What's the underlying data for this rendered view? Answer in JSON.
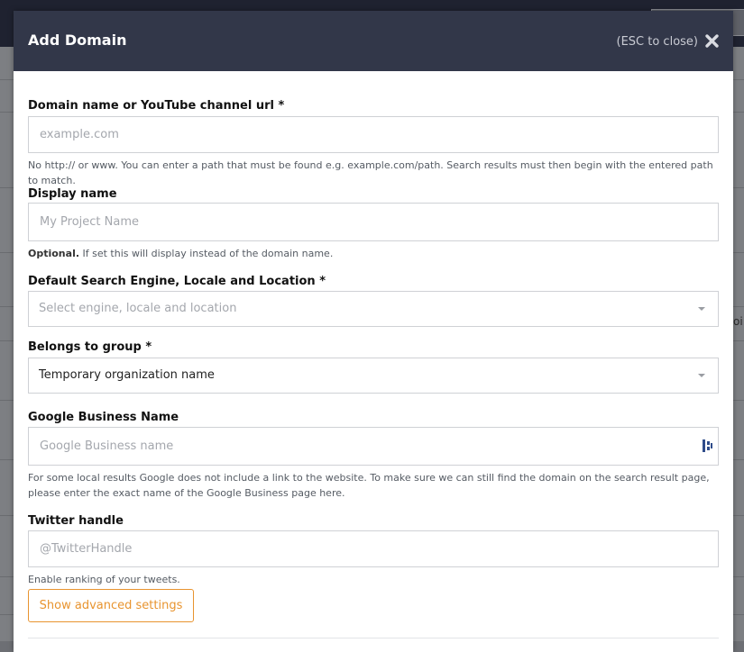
{
  "modal": {
    "title": "Add Domain",
    "esc_hint": "(ESC to close)"
  },
  "fields": {
    "domain": {
      "label": "Domain name or YouTube channel url *",
      "placeholder": "example.com",
      "value": "",
      "help": "No http:// or www. You can enter a path that must be found e.g. example.com/path. Search results must then begin with the entered path to match."
    },
    "display_name": {
      "label": "Display name",
      "placeholder": "My Project Name",
      "value": "",
      "help_bold": "Optional.",
      "help": "If set this will display instead of the domain name."
    },
    "search_engine": {
      "label": "Default Search Engine, Locale and Location *",
      "placeholder": "Select engine, locale and location"
    },
    "group": {
      "label": "Belongs to group *",
      "selected": "Temporary organization name"
    },
    "google_business": {
      "label": "Google Business Name",
      "placeholder": "Google Business name",
      "value": "",
      "help": "For some local results Google does not include a link to the website. To make sure we can still find the domain on the search result page, please enter the exact name of the Google Business page here."
    },
    "twitter": {
      "label": "Twitter handle",
      "placeholder": "@TwitterHandle",
      "value": "",
      "help": "Enable ranking of your tweets."
    }
  },
  "advanced_button": "Show advanced settings",
  "background": {
    "edge_text": "oi"
  },
  "colors": {
    "header": "#323749",
    "accent": "#e8942f",
    "topbar": "#1f2230"
  },
  "icons": {
    "close": "close-icon",
    "business": "business-icon"
  }
}
